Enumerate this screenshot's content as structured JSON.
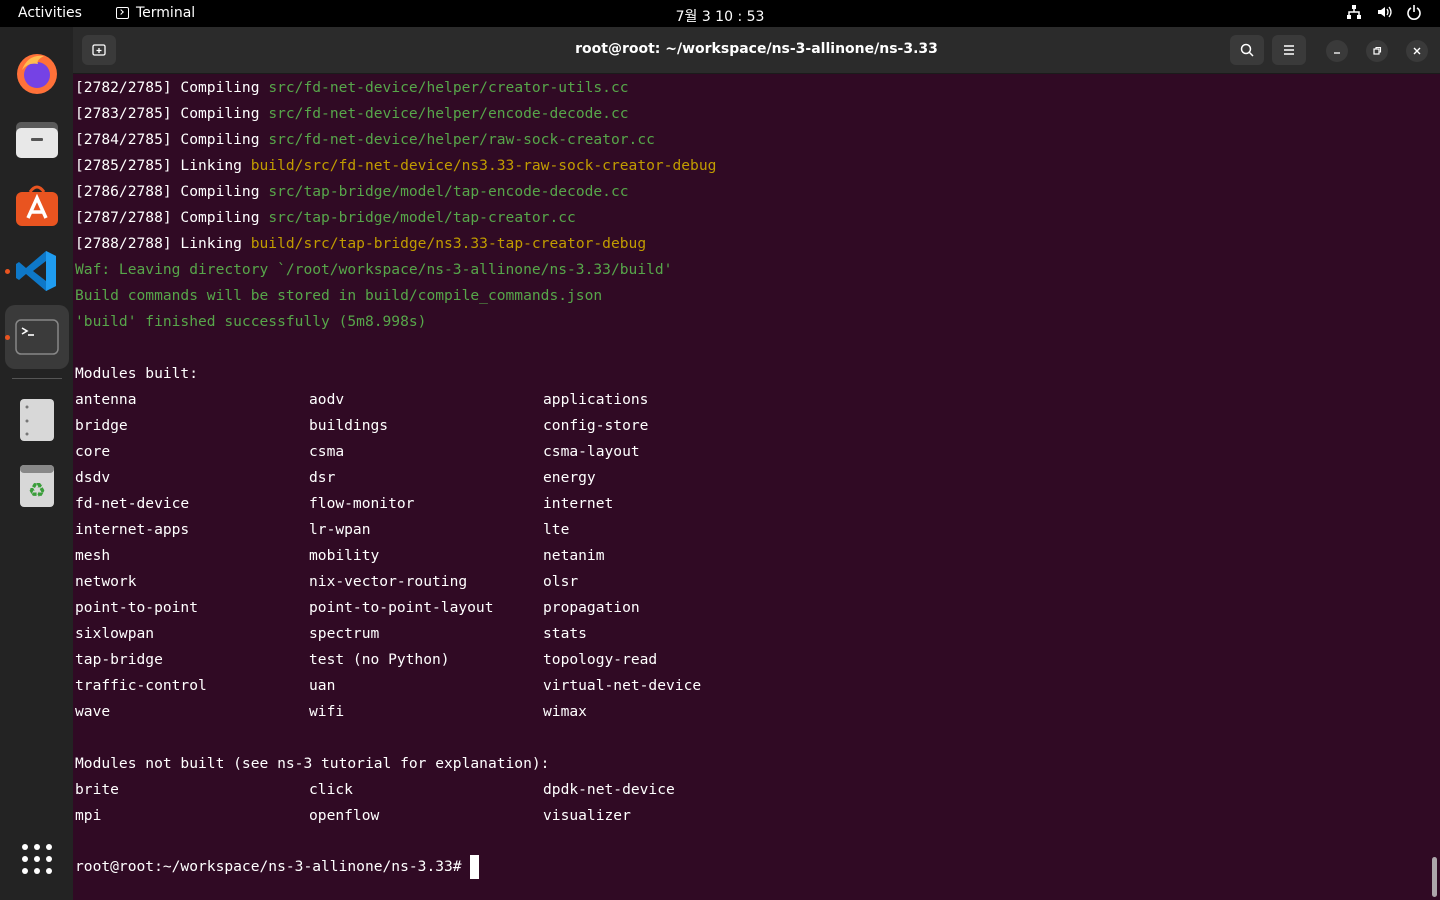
{
  "topbar": {
    "activities": "Activities",
    "app_name": "Terminal",
    "clock": "7월 3 10 : 53"
  },
  "window": {
    "title": "root@root: ~/workspace/ns-3-allinone/ns-3.33"
  },
  "terminal": {
    "build_lines": [
      {
        "prefix": "[2782/2785] Compiling",
        "path": "src/fd-net-device/helper/creator-utils.cc",
        "kind": "compile"
      },
      {
        "prefix": "[2783/2785] Compiling",
        "path": "src/fd-net-device/helper/encode-decode.cc",
        "kind": "compile"
      },
      {
        "prefix": "[2784/2785] Compiling",
        "path": "src/fd-net-device/helper/raw-sock-creator.cc",
        "kind": "compile"
      },
      {
        "prefix": "[2785/2785] Linking",
        "path": "build/src/fd-net-device/ns3.33-raw-sock-creator-debug",
        "kind": "link"
      },
      {
        "prefix": "[2786/2788] Compiling",
        "path": "src/tap-bridge/model/tap-encode-decode.cc",
        "kind": "compile"
      },
      {
        "prefix": "[2787/2788] Compiling",
        "path": "src/tap-bridge/model/tap-creator.cc",
        "kind": "compile"
      },
      {
        "prefix": "[2788/2788] Linking",
        "path": "build/src/tap-bridge/ns3.33-tap-creator-debug",
        "kind": "link"
      }
    ],
    "status_lines": [
      "Waf: Leaving directory `/root/workspace/ns-3-allinone/ns-3.33/build'",
      "Build commands will be stored in build/compile_commands.json",
      "'build' finished successfully (5m8.998s)"
    ],
    "modules_built_header": "Modules built:",
    "modules_built": [
      [
        "antenna",
        "aodv",
        "applications"
      ],
      [
        "bridge",
        "buildings",
        "config-store"
      ],
      [
        "core",
        "csma",
        "csma-layout"
      ],
      [
        "dsdv",
        "dsr",
        "energy"
      ],
      [
        "fd-net-device",
        "flow-monitor",
        "internet"
      ],
      [
        "internet-apps",
        "lr-wpan",
        "lte"
      ],
      [
        "mesh",
        "mobility",
        "netanim"
      ],
      [
        "network",
        "nix-vector-routing",
        "olsr"
      ],
      [
        "point-to-point",
        "point-to-point-layout",
        "propagation"
      ],
      [
        "sixlowpan",
        "spectrum",
        "stats"
      ],
      [
        "tap-bridge",
        "test (no Python)",
        "topology-read"
      ],
      [
        "traffic-control",
        "uan",
        "virtual-net-device"
      ],
      [
        "wave",
        "wifi",
        "wimax"
      ]
    ],
    "modules_not_built_header": "Modules not built (see ns-3 tutorial for explanation):",
    "modules_not_built": [
      [
        "brite",
        "click",
        "dpdk-net-device"
      ],
      [
        "mpi",
        "openflow",
        "visualizer"
      ]
    ],
    "prompt": "root@root:~/workspace/ns-3-allinone/ns-3.33#"
  },
  "dock": {
    "items": [
      "firefox-icon",
      "files-icon",
      "app-center-icon",
      "vscode-icon",
      "terminal-icon",
      "drive-icon",
      "trash-icon",
      "show-apps-icon"
    ]
  }
}
